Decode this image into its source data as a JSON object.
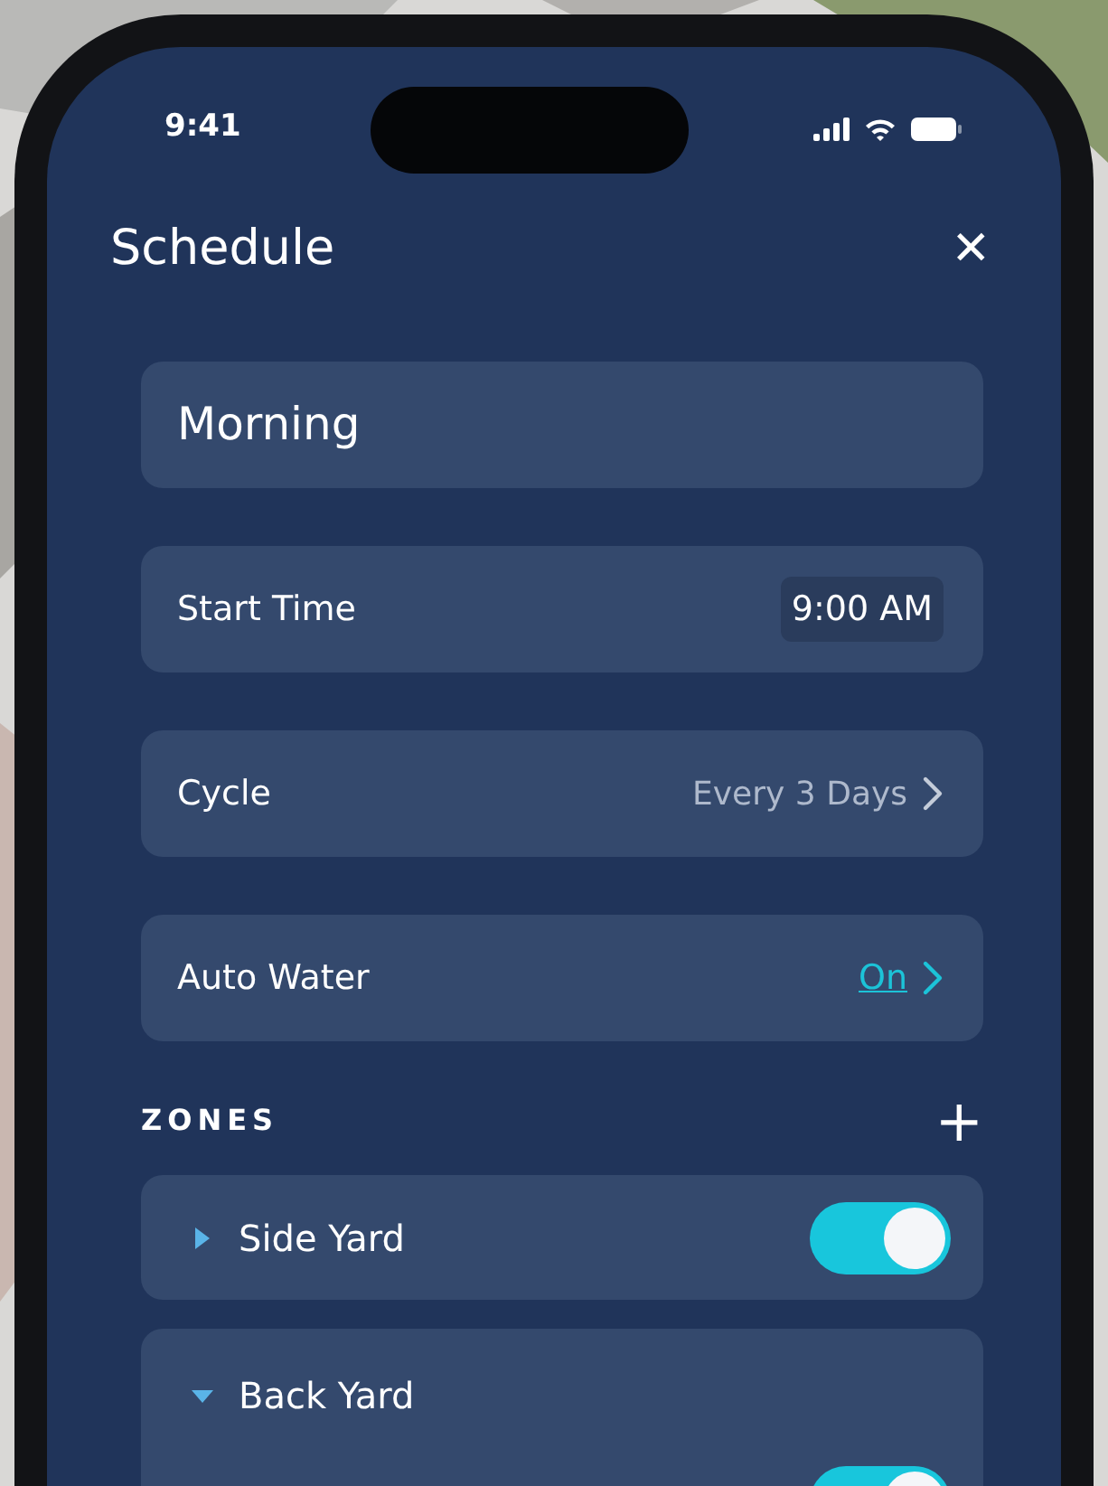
{
  "status_bar": {
    "time": "9:41"
  },
  "header": {
    "title": "Schedule",
    "close": "✕"
  },
  "fields": [
    {
      "kind": "name",
      "value": "Morning"
    },
    {
      "kind": "time",
      "label": "Start Time",
      "value": "9:00 AM"
    },
    {
      "kind": "select",
      "label": "Cycle",
      "value": "Every 3 Days"
    },
    {
      "kind": "link",
      "label": "Auto Water",
      "value": "On"
    }
  ],
  "zones": {
    "title": "ZONES",
    "add": "+",
    "items": [
      {
        "name": "Side Yard",
        "expanded": false,
        "on": true
      },
      {
        "name": "Back Yard",
        "expanded": true,
        "on": true
      }
    ]
  }
}
